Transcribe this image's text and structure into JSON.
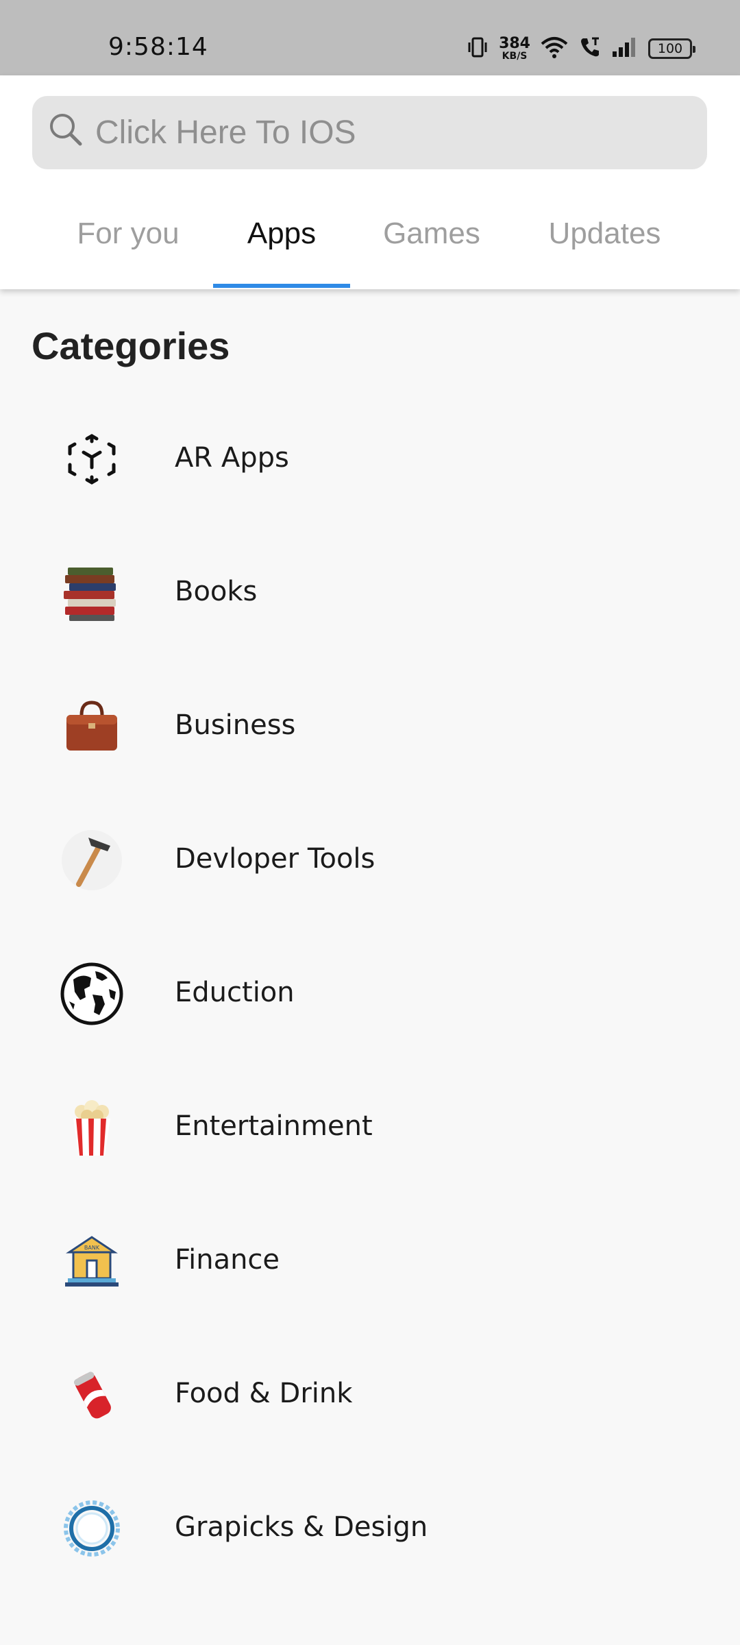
{
  "status_bar": {
    "time": "9:58:14",
    "net_speed_value": "384",
    "net_speed_unit": "KB/S",
    "battery": "100",
    "icons": [
      "vibrate-icon",
      "wifi-icon",
      "call-icon",
      "signal-icon",
      "battery-icon"
    ]
  },
  "search": {
    "placeholder": "Click Here To IOS",
    "icon": "search-icon"
  },
  "tabs": [
    {
      "label": "For you",
      "active": false
    },
    {
      "label": "Apps",
      "active": true
    },
    {
      "label": "Games",
      "active": false
    },
    {
      "label": "Updates",
      "active": false
    }
  ],
  "colors": {
    "accent": "#2f8ae6",
    "status_bar": "#bdbdbd",
    "search_bg": "#e4e4e4",
    "page_bg": "#f8f8f8"
  },
  "content": {
    "title": "Categories",
    "categories": [
      {
        "label": "AR Apps",
        "icon": "ar-cube-icon"
      },
      {
        "label": "Books",
        "icon": "books-icon"
      },
      {
        "label": "Business",
        "icon": "briefcase-icon"
      },
      {
        "label": "Devloper Tools",
        "icon": "hammer-icon"
      },
      {
        "label": "Eduction",
        "icon": "globe-icon"
      },
      {
        "label": "Entertainment",
        "icon": "popcorn-icon"
      },
      {
        "label": "Finance",
        "icon": "bank-icon"
      },
      {
        "label": "Food & Drink",
        "icon": "soda-can-icon"
      },
      {
        "label": "Grapicks & Design",
        "icon": "ring-icon"
      }
    ]
  }
}
